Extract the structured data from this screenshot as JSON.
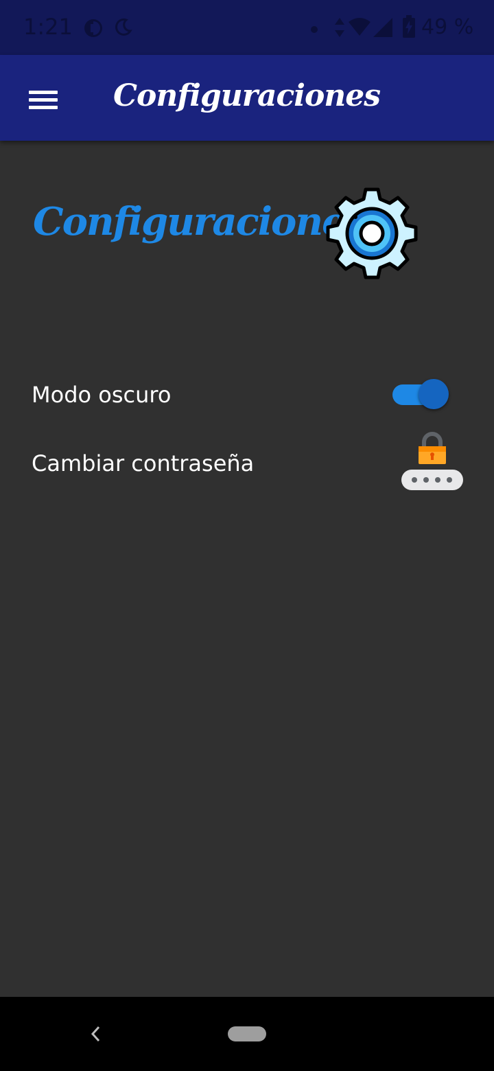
{
  "status_bar": {
    "time": "1:21",
    "battery_text": "49 %",
    "icons": [
      "data-saver-icon",
      "do-not-disturb-icon",
      "notification-dot-icon",
      "data-arrows-icon",
      "wifi-icon",
      "signal-icon",
      "battery-charging-icon"
    ]
  },
  "app_bar": {
    "title": "Configuraciones",
    "menu_icon": "hamburger-menu-icon"
  },
  "page": {
    "heading": "Configuraciones",
    "heading_icon": "gear-icon"
  },
  "settings": [
    {
      "label": "Modo oscuro",
      "control": "toggle",
      "on": true
    },
    {
      "label": "Cambiar contraseña",
      "control": "icon-button",
      "icon": "password-lock-icon"
    }
  ],
  "nav_bar": {
    "back_icon": "back-icon",
    "home_icon": "home-pill-icon"
  },
  "colors": {
    "status_bar": "#121858",
    "app_bar": "#1a237e",
    "background": "#303030",
    "accent": "#1e88e5",
    "toggle_thumb": "#1565c0",
    "nav_bar": "#000000"
  }
}
